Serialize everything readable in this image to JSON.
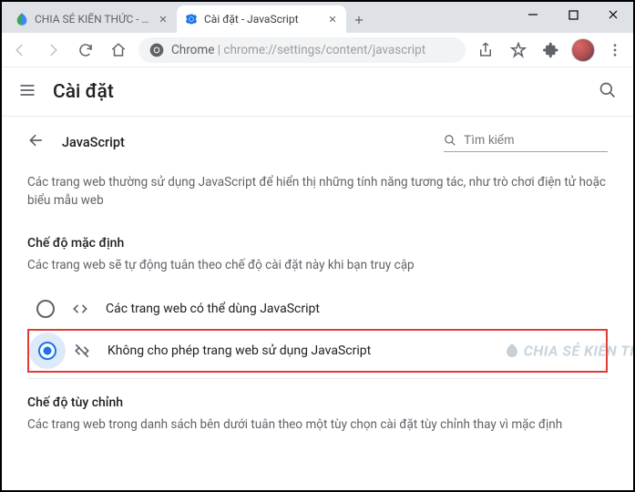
{
  "window": {
    "tabs": [
      {
        "title": "CHIA SẺ KIẾN THỨC - Trang",
        "active": false,
        "favicon": "leaf"
      },
      {
        "title": "Cài đặt - JavaScript",
        "active": true,
        "favicon": "gear"
      }
    ]
  },
  "addressbar": {
    "prefix": "Chrome",
    "separator": " | ",
    "path": "chrome://settings/content/javascript"
  },
  "header": {
    "title": "Cài đặt"
  },
  "page": {
    "back_label": "←",
    "section_title": "JavaScript",
    "search_placeholder": "Tìm kiếm",
    "description": "Các trang web thường sử dụng JavaScript để hiển thị những tính năng tương tác, như trò chơi điện tử hoặc biểu mẫu web",
    "default_behavior": {
      "title": "Chế độ mặc định",
      "description": "Các trang web sẽ tự động tuân theo chế độ cài đặt này khi bạn truy cập",
      "options": [
        {
          "label": "Các trang web có thể dùng JavaScript",
          "selected": false,
          "icon": "code"
        },
        {
          "label": "Không cho phép trang web sử dụng JavaScript",
          "selected": true,
          "icon": "code-off"
        }
      ]
    },
    "custom_behavior": {
      "title": "Chế độ tùy chỉnh",
      "description": "Các trang web trong danh sách bên dưới tuân theo một tùy chọn cài đặt tùy chỉnh thay vì mặc định"
    }
  },
  "watermark": "CHIA SẺ KIẾN THỨC"
}
